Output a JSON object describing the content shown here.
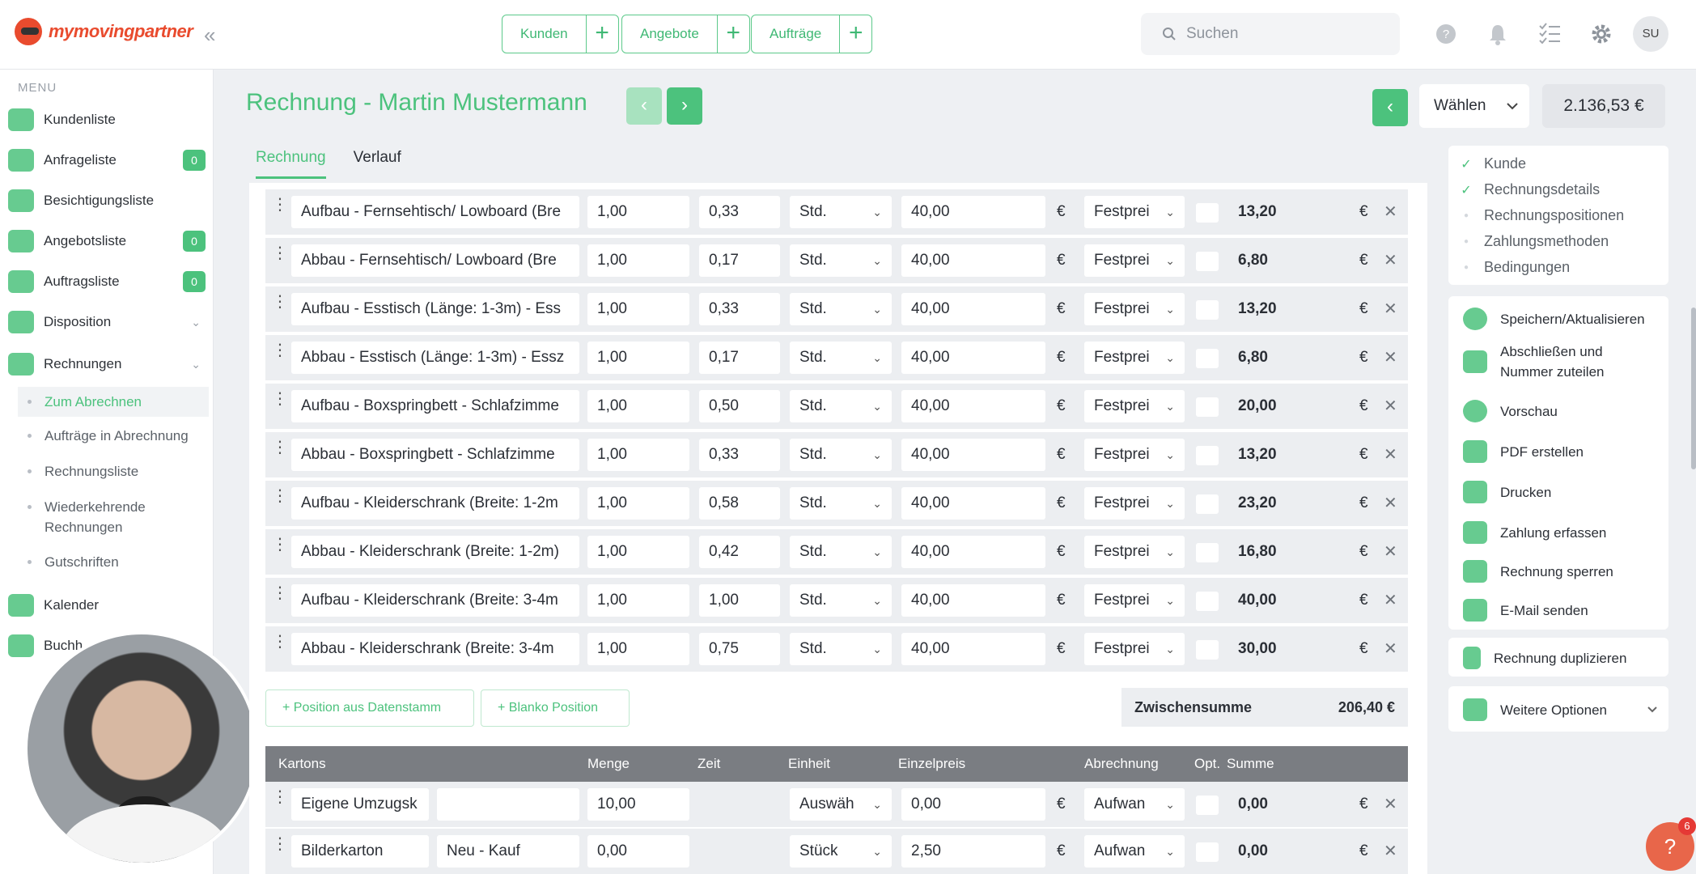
{
  "header": {
    "logo_text": "mymovingpartner",
    "collapse_glyph": "«",
    "groups": [
      {
        "label": "Kunden",
        "plus": "+"
      },
      {
        "label": "Angebote",
        "plus": "+"
      },
      {
        "label": "Aufträge",
        "plus": "+"
      }
    ],
    "search_placeholder": "Suchen",
    "avatar": "SU"
  },
  "sidebar": {
    "menu_heading": "MENU",
    "items": [
      {
        "label": "Kundenliste",
        "icon": "users-icon"
      },
      {
        "label": "Anfrageliste",
        "badge": "0",
        "icon": "inbox-icon"
      },
      {
        "label": "Besichtigungsliste",
        "icon": "house-icon"
      },
      {
        "label": "Angebotsliste",
        "badge": "0",
        "icon": "offer-icon"
      },
      {
        "label": "Auftragsliste",
        "badge": "0",
        "icon": "order-icon"
      },
      {
        "label": "Disposition",
        "chevron": "⌄",
        "icon": "disposition-icon"
      },
      {
        "label": "Rechnungen",
        "chevron": "⌄",
        "icon": "invoice-icon"
      }
    ],
    "subitems": [
      "Zum Abrechnen",
      "Aufträge in Abrechnung",
      "Rechnungsliste",
      "Wiederkehrende Rechnungen",
      "Gutschriften"
    ],
    "bottom_items": [
      {
        "label": "Kalender",
        "icon": "calendar-icon"
      },
      {
        "label": "Buchh",
        "icon": "accounting-icon"
      }
    ]
  },
  "page": {
    "title": "Rechnung - Martin Mustermann",
    "prev": "‹",
    "next": "›",
    "back": "‹",
    "select_label": "Wählen",
    "total": "2.136,53 €",
    "tabs": [
      "Rechnung",
      "Verlauf"
    ]
  },
  "positions": [
    {
      "desc": "Aufbau - Fernsehtisch/ Lowboard (Bre",
      "qty": "1,00",
      "time": "0,33",
      "unit": "Std.",
      "price": "40,00",
      "cur": "€",
      "billing": "Festprei",
      "sum": "13,20"
    },
    {
      "desc": "Abbau - Fernsehtisch/ Lowboard (Bre",
      "qty": "1,00",
      "time": "0,17",
      "unit": "Std.",
      "price": "40,00",
      "cur": "€",
      "billing": "Festprei",
      "sum": "6,80"
    },
    {
      "desc": "Aufbau - Esstisch (Länge: 1-3m) - Ess",
      "qty": "1,00",
      "time": "0,33",
      "unit": "Std.",
      "price": "40,00",
      "cur": "€",
      "billing": "Festprei",
      "sum": "13,20"
    },
    {
      "desc": "Abbau - Esstisch (Länge: 1-3m) - Essz",
      "qty": "1,00",
      "time": "0,17",
      "unit": "Std.",
      "price": "40,00",
      "cur": "€",
      "billing": "Festprei",
      "sum": "6,80"
    },
    {
      "desc": "Aufbau - Boxspringbett - Schlafzimme",
      "qty": "1,00",
      "time": "0,50",
      "unit": "Std.",
      "price": "40,00",
      "cur": "€",
      "billing": "Festprei",
      "sum": "20,00"
    },
    {
      "desc": "Abbau - Boxspringbett - Schlafzimme",
      "qty": "1,00",
      "time": "0,33",
      "unit": "Std.",
      "price": "40,00",
      "cur": "€",
      "billing": "Festprei",
      "sum": "13,20"
    },
    {
      "desc": "Aufbau - Kleiderschrank (Breite: 1-2m",
      "qty": "1,00",
      "time": "0,58",
      "unit": "Std.",
      "price": "40,00",
      "cur": "€",
      "billing": "Festprei",
      "sum": "23,20"
    },
    {
      "desc": "Abbau - Kleiderschrank (Breite: 1-2m)",
      "qty": "1,00",
      "time": "0,42",
      "unit": "Std.",
      "price": "40,00",
      "cur": "€",
      "billing": "Festprei",
      "sum": "16,80"
    },
    {
      "desc": "Aufbau - Kleiderschrank (Breite: 3-4m",
      "qty": "1,00",
      "time": "1,00",
      "unit": "Std.",
      "price": "40,00",
      "cur": "€",
      "billing": "Festprei",
      "sum": "40,00"
    },
    {
      "desc": "Abbau - Kleiderschrank (Breite: 3-4m",
      "qty": "1,00",
      "time": "0,75",
      "unit": "Std.",
      "price": "40,00",
      "cur": "€",
      "billing": "Festprei",
      "sum": "30,00"
    }
  ],
  "actions_bar": {
    "add_from_master": "+   Position aus Datenstamm",
    "add_blank": "+   Blanko Position",
    "subtotal_label": "Zwischensumme",
    "subtotal_value": "206,40  €"
  },
  "kartons": {
    "headers": [
      "Kartons",
      "Menge",
      "Zeit",
      "Einheit",
      "Einzelpreis",
      "Abrechnung",
      "Opt.",
      "Summe"
    ],
    "rows": [
      {
        "name": "Eigene Umzugsk",
        "note": "",
        "qty": "10,00",
        "unit": "Auswäh",
        "price": "0,00",
        "cur": "€",
        "billing": "Aufwan",
        "sum": "0,00"
      },
      {
        "name": "Bilderkarton",
        "note": "Neu - Kauf",
        "qty": "0,00",
        "unit": "Stück",
        "price": "2,50",
        "cur": "€",
        "billing": "Aufwan",
        "sum": "0,00"
      }
    ]
  },
  "steps": [
    {
      "label": "Kunde",
      "done": true
    },
    {
      "label": "Rechnungsdetails",
      "done": true
    },
    {
      "label": "Rechnungspositionen",
      "done": false
    },
    {
      "label": "Zahlungsmethoden",
      "done": false
    },
    {
      "label": "Bedingungen",
      "done": false
    }
  ],
  "actions": [
    {
      "label": "Speichern/Aktualisieren",
      "icon": "check-circle-icon"
    },
    {
      "label": "Abschließen und Nummer zuteilen",
      "icon": "hash-icon"
    },
    {
      "label": "Vorschau",
      "icon": "magnifier-icon"
    },
    {
      "label": "PDF erstellen",
      "icon": "pdf-icon"
    },
    {
      "label": "Drucken",
      "icon": "printer-icon"
    },
    {
      "label": "Zahlung erfassen",
      "icon": "payment-icon"
    },
    {
      "label": "Rechnung sperren",
      "icon": "lock-icon"
    },
    {
      "label": "E-Mail senden",
      "icon": "mail-icon"
    }
  ],
  "duplicate_label": "Rechnung duplizieren",
  "more_options_label": "Weitere Optionen",
  "help_badge": "6"
}
